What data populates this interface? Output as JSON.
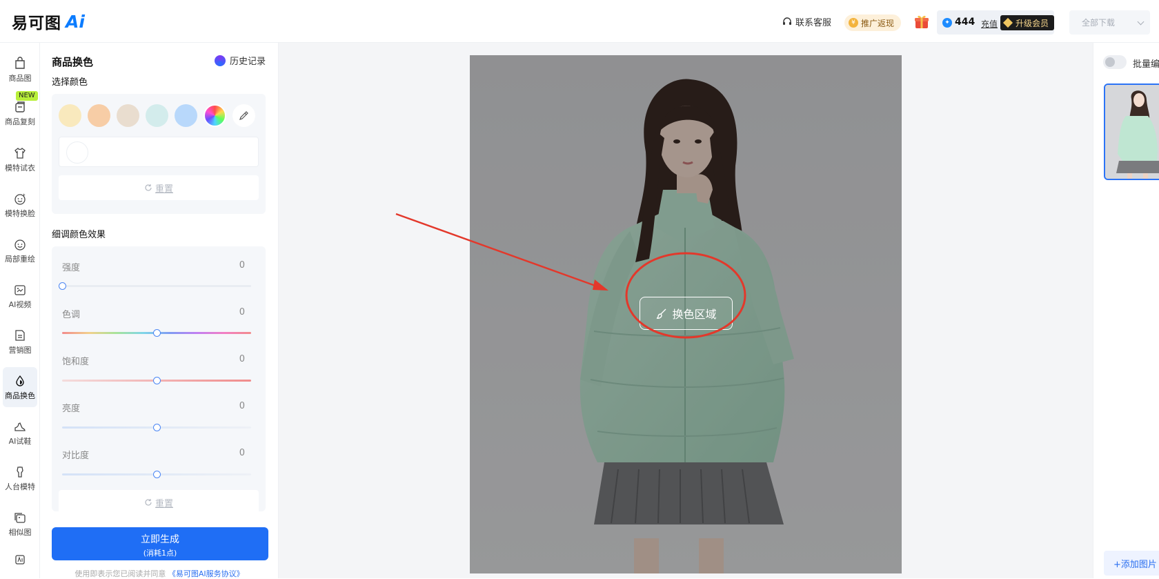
{
  "header": {
    "logo_text": "易可图",
    "logo_ai": "Ai",
    "service_label": "联系客服",
    "promo_label": "推广返现",
    "points_value": "444",
    "recharge_label": "充值",
    "upgrade_label": "升级会员",
    "download_label": "全部下载"
  },
  "nav": {
    "items": [
      {
        "label": "商品图",
        "icon": "bag-icon"
      },
      {
        "label": "商品复刻",
        "icon": "copy-box-icon",
        "badge": "NEW"
      },
      {
        "label": "模特试衣",
        "icon": "tshirt-icon"
      },
      {
        "label": "模特换脸",
        "icon": "face-icon"
      },
      {
        "label": "局部重绘",
        "icon": "face-edit-icon"
      },
      {
        "label": "AI视频",
        "icon": "video-icon"
      },
      {
        "label": "营销图",
        "icon": "poster-icon"
      },
      {
        "label": "商品换色",
        "icon": "drop-icon",
        "active": true
      },
      {
        "label": "AI试鞋",
        "icon": "shoe-icon"
      },
      {
        "label": "人台模特",
        "icon": "mannequin-icon"
      },
      {
        "label": "相似图",
        "icon": "images-icon"
      }
    ]
  },
  "panel": {
    "title": "商品换色",
    "history_label": "历史记录",
    "select_color_label": "选择颜色",
    "swatches": [
      "#f9e9bd",
      "#f7cda6",
      "#e9ddcf",
      "#d3ecec",
      "#b8d8fb"
    ],
    "reset_label": "重置",
    "fine_tune_label": "细调颜色效果",
    "sliders": [
      {
        "label": "强度",
        "value": 0,
        "position": 0.0,
        "track": "plain"
      },
      {
        "label": "色调",
        "value": 0,
        "position": 0.5,
        "track": "hue"
      },
      {
        "label": "饱和度",
        "value": 0,
        "position": 0.5,
        "track": "saturation"
      },
      {
        "label": "亮度",
        "value": 0,
        "position": 0.5,
        "track": "light"
      },
      {
        "label": "对比度",
        "value": 0,
        "position": 0.5,
        "track": "light"
      }
    ],
    "reset2_label": "重置",
    "generate_label": "立即生成",
    "generate_cost": "(消耗1点)",
    "agreement_text": "使用即表示您已阅读并同意",
    "agreement_link": "《易可图AI服务协议》"
  },
  "canvas": {
    "region_label": "换色区域",
    "annotation_color": "#e3382b"
  },
  "right": {
    "batch_label": "批量编",
    "add_image_label": "+添加图片"
  }
}
